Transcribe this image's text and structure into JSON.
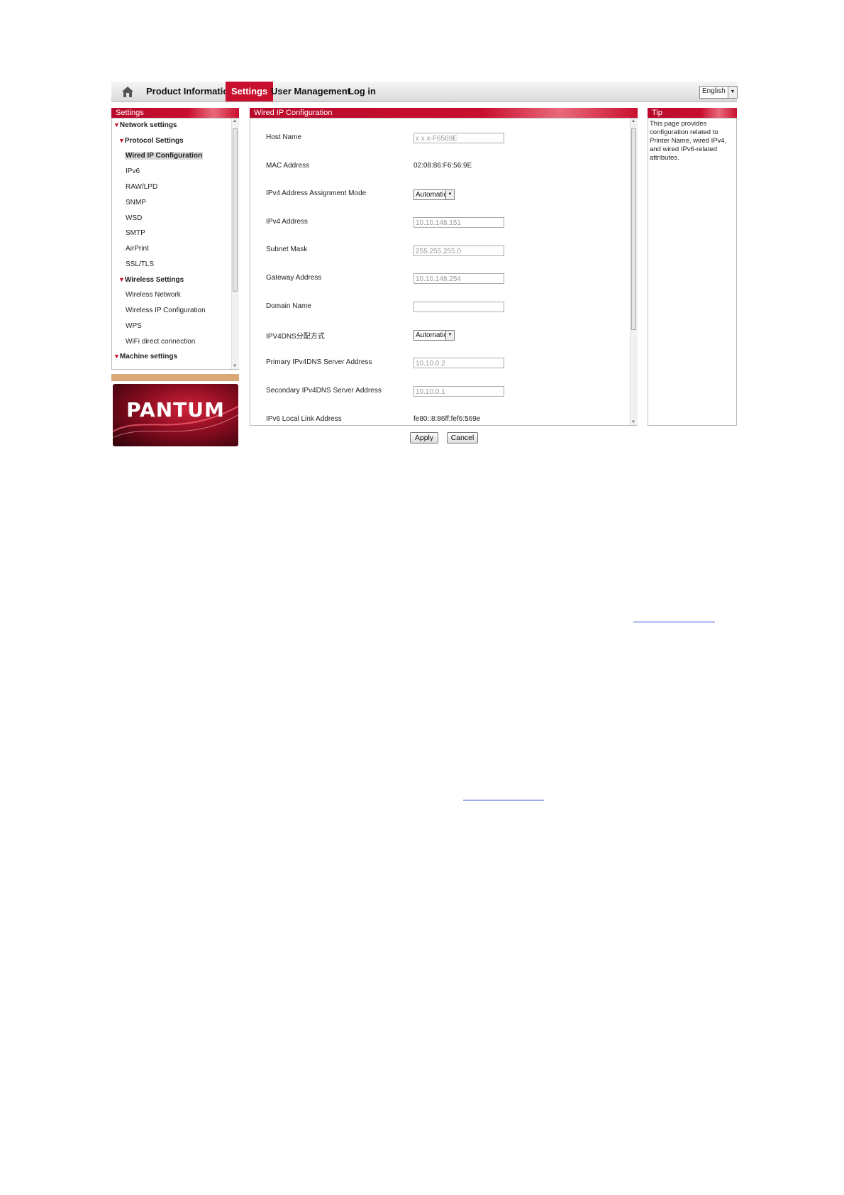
{
  "nav": {
    "items": [
      "Product Information",
      "Settings",
      "User Management",
      "Log in"
    ],
    "active": "Settings",
    "language": "English"
  },
  "sidebar": {
    "title": "Settings",
    "items": [
      {
        "label": "Network settings",
        "level": 0,
        "expanded": true
      },
      {
        "label": "Protocol Settings",
        "level": 1,
        "expanded": true
      },
      {
        "label": "Wired IP Configuration",
        "level": 2,
        "selected": true
      },
      {
        "label": "IPv6",
        "level": 2
      },
      {
        "label": "RAW/LPD",
        "level": 2
      },
      {
        "label": "SNMP",
        "level": 2
      },
      {
        "label": "WSD",
        "level": 2
      },
      {
        "label": "SMTP",
        "level": 2
      },
      {
        "label": "AirPrint",
        "level": 2
      },
      {
        "label": "SSL/TLS",
        "level": 2
      },
      {
        "label": "Wireless Settings",
        "level": 1,
        "expanded": true
      },
      {
        "label": "Wireless Network",
        "level": 2
      },
      {
        "label": "Wireless IP Configuration",
        "level": 2
      },
      {
        "label": "WPS",
        "level": 2
      },
      {
        "label": "WiFi direct connection",
        "level": 2
      },
      {
        "label": "Machine settings",
        "level": 0,
        "expanded": true
      }
    ]
  },
  "logo": {
    "text": "PANTUM"
  },
  "main": {
    "title": "Wired IP Configuration",
    "fields": [
      {
        "label": "Host Name",
        "kind": "input",
        "value": "x x x-F6569E"
      },
      {
        "label": "MAC Address",
        "kind": "text",
        "value": "02:08:86:F6:56:9E"
      },
      {
        "label": "IPv4 Address Assignment Mode",
        "kind": "select",
        "value": "Automatic"
      },
      {
        "label": "IPv4 Address",
        "kind": "input",
        "value": "10.10.148.151"
      },
      {
        "label": "Subnet Mask",
        "kind": "input",
        "value": "255.255.255.0"
      },
      {
        "label": "Gateway Address",
        "kind": "input",
        "value": "10.10.148.254"
      },
      {
        "label": "Domain Name",
        "kind": "input",
        "value": ""
      },
      {
        "label": "IPV4DNS分配方式",
        "kind": "select",
        "value": "Automatic"
      },
      {
        "label": "Primary IPv4DNS Server Address",
        "kind": "input",
        "value": "10.10.0.2"
      },
      {
        "label": "Secondary IPv4DNS Server Address",
        "kind": "input",
        "value": "10.10.0.1"
      },
      {
        "label": "IPv6 Local Link Address",
        "kind": "text",
        "value": "fe80::8:86ff:fef6:569e"
      }
    ],
    "apply_label": "Apply",
    "cancel_label": "Cancel"
  },
  "tip": {
    "title": "Tip",
    "text": "This page provides configuration related to Printer Name, wired IPv4, and wired IPv6-related attributes."
  },
  "colors": {
    "accent": "#c8102e",
    "tan": "#d9a877",
    "link": "#2a3fd1"
  }
}
